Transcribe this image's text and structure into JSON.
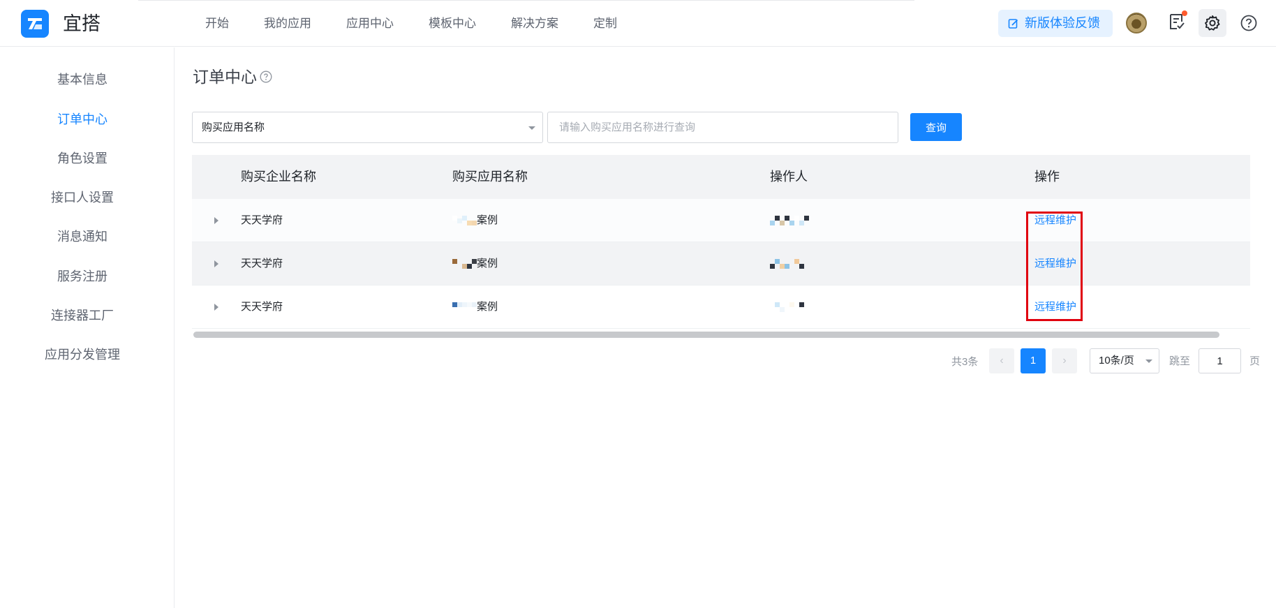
{
  "header": {
    "brand": "宜搭",
    "nav": [
      "开始",
      "我的应用",
      "应用中心",
      "模板中心",
      "解决方案",
      "定制"
    ],
    "feedback_label": "新版体验反馈",
    "colors": {
      "accent": "#1685ff",
      "notice_dot": "#ff5b2e"
    }
  },
  "sidebar": {
    "items": [
      {
        "label": "基本信息",
        "active": false
      },
      {
        "label": "订单中心",
        "active": true
      },
      {
        "label": "角色设置",
        "active": false
      },
      {
        "label": "接口人设置",
        "active": false
      },
      {
        "label": "消息通知",
        "active": false
      },
      {
        "label": "服务注册",
        "active": false
      },
      {
        "label": "连接器工厂",
        "active": false
      },
      {
        "label": "应用分发管理",
        "active": false
      }
    ]
  },
  "main": {
    "title": "订单中心",
    "filter": {
      "field_selected": "购买应用名称",
      "search_placeholder": "请输入购买应用名称进行查询",
      "query_label": "查询"
    },
    "table": {
      "columns": [
        "购买企业名称",
        "购买应用名称",
        "操作人",
        "操作"
      ],
      "rows": [
        {
          "company": "天天学府",
          "app_suffix": "案例",
          "action": "远程维护"
        },
        {
          "company": "天天学府",
          "app_suffix": "案例",
          "action": "远程维护"
        },
        {
          "company": "天天学府",
          "app_suffix": "案例",
          "action": "远程维护"
        }
      ]
    },
    "pagination": {
      "total": "共3条",
      "prev": "‹",
      "current": "1",
      "next": "›",
      "page_size": "10条/页",
      "jump_label": "跳至",
      "jump_value": "1",
      "jump_unit": "页"
    }
  }
}
